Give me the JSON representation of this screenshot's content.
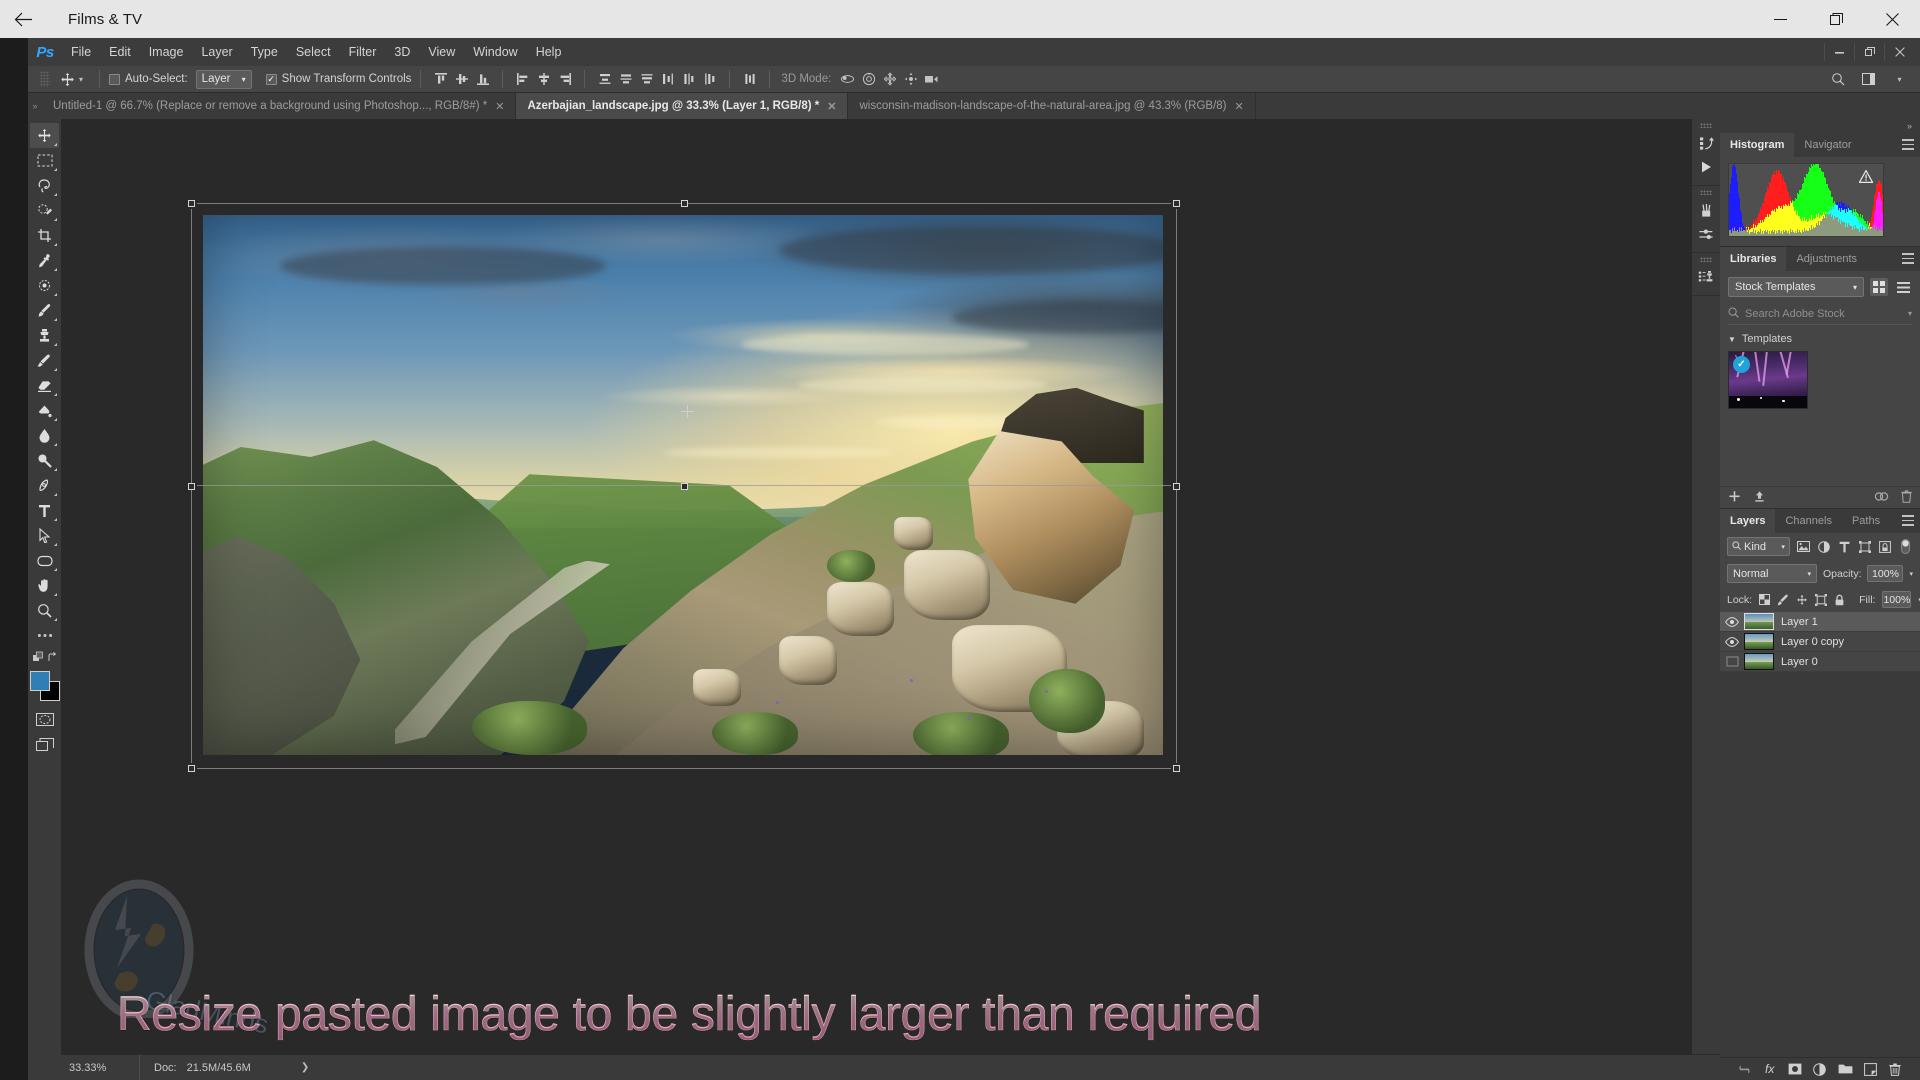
{
  "window": {
    "title": "Films & TV",
    "back_icon": "back-arrow-icon",
    "minimize": "–",
    "maximize": "❐",
    "close": "✕"
  },
  "photoshop": {
    "logo": "Ps",
    "menus": [
      "File",
      "Edit",
      "Image",
      "Layer",
      "Type",
      "Select",
      "Filter",
      "3D",
      "View",
      "Window",
      "Help"
    ],
    "win_controls": {
      "minimize": "—",
      "restore": "❐",
      "close": "✕"
    },
    "options_bar": {
      "tool_icon": "move-tool-icon",
      "auto_select_label": "Auto-Select:",
      "auto_select_checked": false,
      "auto_select_value": "Layer",
      "show_transform_label": "Show Transform Controls",
      "show_transform_checked": true,
      "mode_3d_label": "3D Mode:"
    },
    "tabs": [
      {
        "title": "Untitled-1 @ 66.7% (Replace or remove a  background using Photoshop..., RGB/8#) *",
        "active": false,
        "close": "✕"
      },
      {
        "title": "Azerbajian_landscape.jpg @ 33.3% (Layer 1, RGB/8) *",
        "active": true,
        "close": "✕"
      },
      {
        "title": "wisconsin-madison-landscape-of-the-natural-area.jpg @ 43.3% (RGB/8)",
        "active": false,
        "close": "✕"
      }
    ],
    "toolbar": [
      {
        "name": "move-tool",
        "selected": true
      },
      {
        "name": "rectangular-marquee-tool",
        "selected": false
      },
      {
        "name": "lasso-tool",
        "selected": false
      },
      {
        "name": "quick-selection-tool",
        "selected": false
      },
      {
        "name": "crop-tool",
        "selected": false
      },
      {
        "name": "eyedropper-tool",
        "selected": false
      },
      {
        "name": "spot-healing-brush-tool",
        "selected": false
      },
      {
        "name": "brush-tool",
        "selected": false
      },
      {
        "name": "clone-stamp-tool",
        "selected": false
      },
      {
        "name": "history-brush-tool",
        "selected": false
      },
      {
        "name": "eraser-tool",
        "selected": false
      },
      {
        "name": "gradient-tool",
        "selected": false
      },
      {
        "name": "blur-tool",
        "selected": false
      },
      {
        "name": "dodge-tool",
        "selected": false
      },
      {
        "name": "pen-tool",
        "selected": false
      },
      {
        "name": "type-tool",
        "selected": false
      },
      {
        "name": "path-selection-tool",
        "selected": false
      },
      {
        "name": "rounded-rectangle-tool",
        "selected": false
      },
      {
        "name": "hand-tool",
        "selected": false
      },
      {
        "name": "zoom-tool",
        "selected": false
      },
      {
        "name": "edit-toolbar-ellipsis",
        "selected": false
      }
    ],
    "colors": {
      "foreground": "#2f7fb5",
      "background": "#000000"
    },
    "status_bar": {
      "zoom": "33.33%",
      "doc_label": "Doc:",
      "doc_value": "21.5M/45.6M",
      "arrow": "❯"
    },
    "canvas": {
      "caption": "Resize pasted image to be slightly larger than required",
      "watermark_text": "GladMinds"
    },
    "right_rail": [
      {
        "name": "history-icon"
      },
      {
        "name": "play-action-icon"
      },
      {
        "name": "brushes-icon"
      },
      {
        "name": "brush-settings-icon"
      },
      {
        "name": "clone-source-icon"
      }
    ],
    "panels": {
      "histogram": {
        "tabs": [
          "Histogram",
          "Navigator"
        ],
        "active_tab": "Histogram",
        "warning_icon": "uncached-data-warning-icon",
        "menu_icon": "panel-menu-icon"
      },
      "libraries": {
        "tabs": [
          "Libraries",
          "Adjustments"
        ],
        "active_tab": "Libraries",
        "menu_icon": "panel-menu-icon",
        "library_select": "Stock Templates",
        "grid_view_icon": "grid-view-icon",
        "list_view_icon": "list-view-icon",
        "search_placeholder": "Search Adobe Stock",
        "search_icon": "search-icon",
        "group_label": "Templates",
        "item_selected": true,
        "footer_icons": [
          "add-element-icon",
          "upload-icon",
          "sync-creative-cloud-icon",
          "delete-icon"
        ]
      },
      "layers": {
        "tabs": [
          "Layers",
          "Channels",
          "Paths"
        ],
        "active_tab": "Layers",
        "menu_icon": "panel-menu-icon",
        "filter_label": "Kind",
        "filter_icons": [
          "filter-pixel-icon",
          "filter-adjustment-icon",
          "filter-type-icon",
          "filter-shape-icon",
          "filter-smart-object-icon"
        ],
        "filter_toggle": "filter-enable-toggle",
        "blend_mode": "Normal",
        "opacity_label": "Opacity:",
        "opacity_value": "100%",
        "lock_label": "Lock:",
        "lock_icons": [
          "lock-transparent-pixels-icon",
          "lock-image-pixels-icon",
          "lock-position-icon",
          "lock-artboard-nesting-icon",
          "lock-all-icon"
        ],
        "fill_label": "Fill:",
        "fill_value": "100%",
        "items": [
          {
            "name": "Layer 1",
            "visible": true,
            "selected": true
          },
          {
            "name": "Layer 0 copy",
            "visible": true,
            "selected": false
          },
          {
            "name": "Layer 0",
            "visible": false,
            "selected": false
          }
        ],
        "footer_icons": [
          "link-layers-icon",
          "add-layer-style-icon",
          "add-layer-mask-icon",
          "new-fill-adjustment-icon",
          "new-group-icon",
          "new-layer-icon",
          "delete-layer-icon"
        ],
        "fx_label": "fx"
      }
    }
  }
}
